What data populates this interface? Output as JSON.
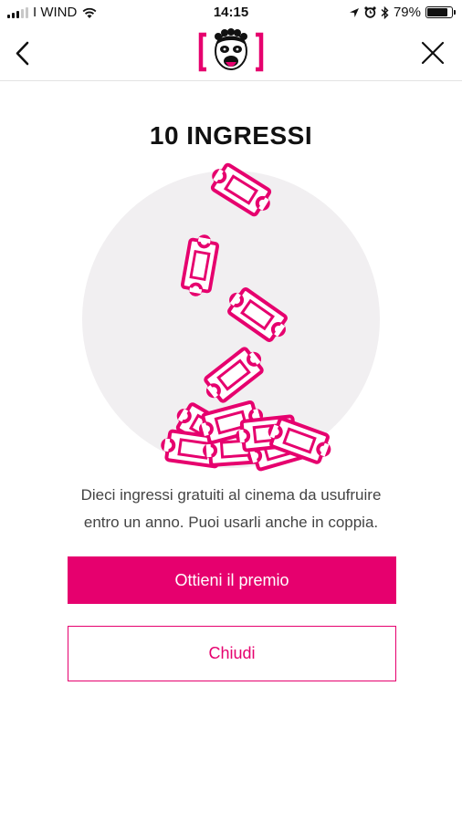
{
  "status_bar": {
    "carrier": "I WIND",
    "time": "14:15",
    "battery": "79%",
    "battery_level": 0.79,
    "icons": [
      "signal-icon",
      "wifi-icon",
      "location-icon",
      "alarm-icon",
      "bluetooth-icon",
      "battery-icon"
    ]
  },
  "nav": {
    "back_icon": "chevron-left-icon",
    "logo_icon": "brand-logo-icon",
    "close_icon": "close-icon"
  },
  "reward": {
    "title": "10 INGRESSI",
    "description_line1": "Dieci ingressi gratuiti al cinema da usufruire",
    "description_line2": "entro un anno. Puoi usarli anche in coppia.",
    "illustration_icon": "cinema-tickets-icon"
  },
  "actions": {
    "primary_label": "Ottieni il premio",
    "secondary_label": "Chiudi"
  },
  "colors": {
    "accent": "#e6006e",
    "circle": "#f1eff1"
  }
}
